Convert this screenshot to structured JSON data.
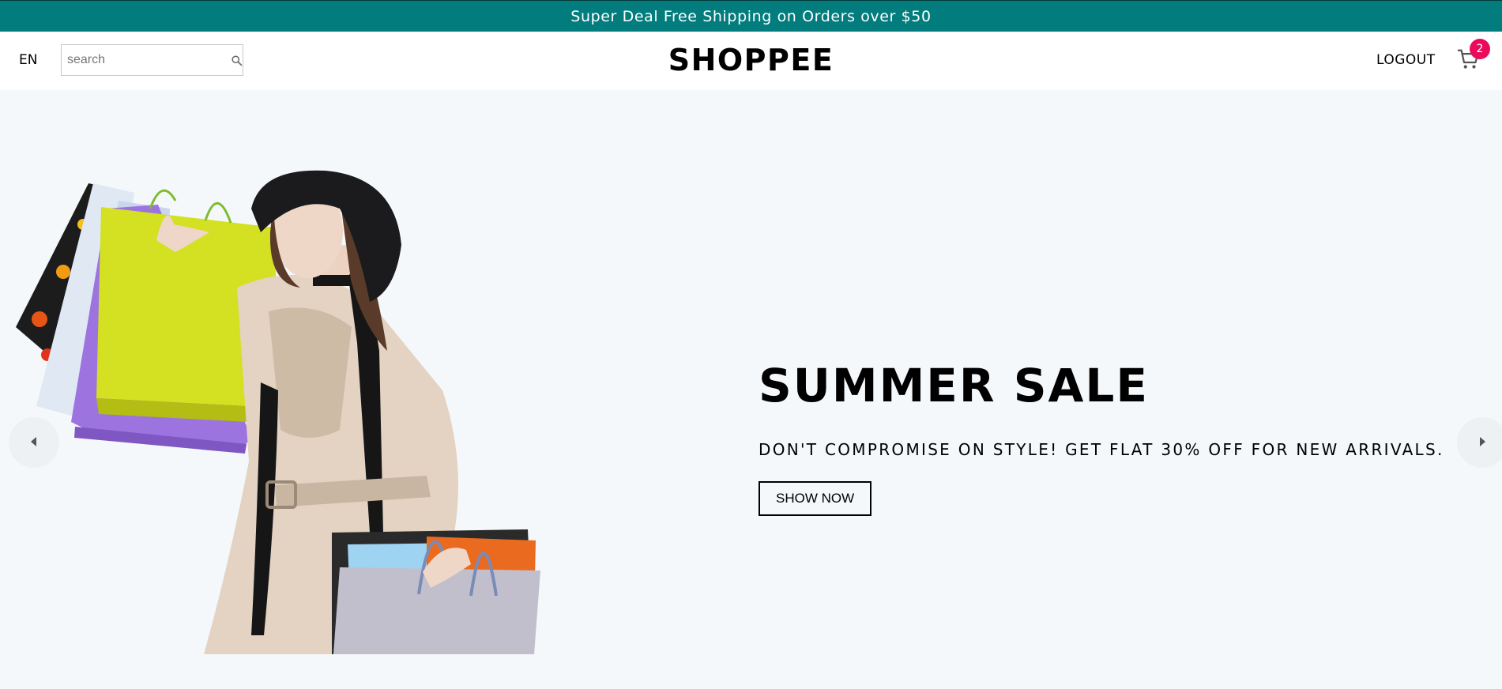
{
  "announcement": {
    "text": "Super Deal Free Shipping on Orders over $50"
  },
  "navbar": {
    "language": "EN",
    "search": {
      "placeholder": "search",
      "value": ""
    },
    "logo": "SHOPPEE",
    "logout_label": "LOGOUT",
    "cart_count": "2",
    "icons": {
      "search": "search-icon",
      "cart": "shopping-cart-icon"
    }
  },
  "hero": {
    "title": "SUMMER SALE",
    "description": "DON'T COMPROMISE ON STYLE! GET FLAT 30% OFF FOR NEW ARRIVALS.",
    "button_label": "SHOW NOW",
    "image": "woman-with-shopping-bags",
    "icons": {
      "prev": "arrow-left-icon",
      "next": "arrow-right-icon"
    }
  },
  "colors": {
    "announcement_bg": "#027c7d",
    "hero_bg": "#f4f8fa",
    "badge": "#ea0b5d"
  }
}
